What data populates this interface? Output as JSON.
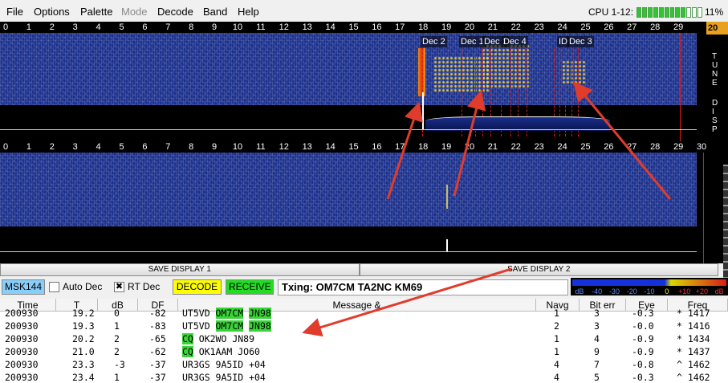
{
  "menu": {
    "items": [
      {
        "label": "File",
        "enabled": true
      },
      {
        "label": "Options",
        "enabled": true
      },
      {
        "label": "Palette",
        "enabled": true
      },
      {
        "label": "Mode",
        "enabled": false
      },
      {
        "label": "Decode",
        "enabled": true
      },
      {
        "label": "Band",
        "enabled": true
      },
      {
        "label": "Help",
        "enabled": true
      }
    ]
  },
  "cpu": {
    "label": "CPU 1-12:",
    "percent": "11%",
    "level": 0.75
  },
  "scale": {
    "ticks": [
      "0",
      "1",
      "2",
      "3",
      "4",
      "5",
      "6",
      "7",
      "8",
      "9",
      "10",
      "11",
      "12",
      "13",
      "14",
      "15",
      "16",
      "17",
      "18",
      "19",
      "20",
      "21",
      "22",
      "23",
      "24",
      "25",
      "26",
      "27",
      "28",
      "29",
      "30"
    ]
  },
  "waterfall_tags": [
    "Dec 2",
    "Dec 1",
    "Dec 1",
    "Dec 4",
    "ID",
    "Dec 3"
  ],
  "side_letters": [
    "T",
    "U",
    "N",
    "E",
    "D",
    "I",
    "S",
    "P"
  ],
  "side_top_label": "20",
  "save": {
    "display1": "SAVE DISPLAY 1",
    "display2": "SAVE DISPLAY 2"
  },
  "controls": {
    "mode": "MSK144",
    "auto_dec": "Auto Dec",
    "auto_dec_checked": false,
    "rt_dec": "RT Dec",
    "rt_dec_checked": true,
    "decode": "DECODE",
    "receive": "RECEIVE",
    "txing": "Txing: OM7CM TA2NC KM69",
    "colors": {
      "mode": "#87cefa",
      "decode": "#ffff00",
      "receive": "#22dd22"
    }
  },
  "meter": {
    "scale": [
      "dB",
      "-40",
      "-30",
      "-20",
      "-10",
      "0",
      "+10",
      "+20",
      "dB"
    ]
  },
  "table": {
    "headers": [
      "Time",
      "T",
      "dB",
      "DF",
      "Message &",
      "Navg",
      "Bit err",
      "Eye",
      "Freq"
    ],
    "rows": [
      {
        "time": "200930",
        "t": "19.2",
        "db": "0",
        "df": "-82",
        "msg": [
          {
            "t": "UT5VD ",
            "h": false
          },
          {
            "t": "OM7CM",
            "h": true
          },
          {
            "t": " ",
            "h": false
          },
          {
            "t": "JN98",
            "h": true
          }
        ],
        "navg": "1",
        "biterr": "3",
        "eye": "-0.3",
        "freq": "* 1417"
      },
      {
        "time": "200930",
        "t": "19.3",
        "db": "1",
        "df": "-83",
        "msg": [
          {
            "t": "UT5VD ",
            "h": false
          },
          {
            "t": "OM7CM",
            "h": true
          },
          {
            "t": " ",
            "h": false
          },
          {
            "t": "JN98",
            "h": true
          }
        ],
        "navg": "2",
        "biterr": "3",
        "eye": "-0.0",
        "freq": "* 1416"
      },
      {
        "time": "200930",
        "t": "20.2",
        "db": "2",
        "df": "-65",
        "msg": [
          {
            "t": "CQ",
            "h": true
          },
          {
            "t": " OK2WO JN89",
            "h": false
          }
        ],
        "navg": "1",
        "biterr": "4",
        "eye": "-0.9",
        "freq": "* 1434"
      },
      {
        "time": "200930",
        "t": "21.0",
        "db": "2",
        "df": "-62",
        "msg": [
          {
            "t": "CQ",
            "h": true
          },
          {
            "t": " OK1AAM JO60",
            "h": false
          }
        ],
        "navg": "1",
        "biterr": "9",
        "eye": "-0.9",
        "freq": "* 1437"
      },
      {
        "time": "200930",
        "t": "23.3",
        "db": "-3",
        "df": "-37",
        "msg": [
          {
            "t": "UR3GS 9A5ID +04",
            "h": false
          }
        ],
        "navg": "4",
        "biterr": "7",
        "eye": "-0.8",
        "freq": "^ 1462"
      },
      {
        "time": "200930",
        "t": "23.4",
        "db": "1",
        "df": "-37",
        "msg": [
          {
            "t": "UR3GS 9A5ID +04",
            "h": false
          }
        ],
        "navg": "4",
        "biterr": "5",
        "eye": "-0.3",
        "freq": "^ 1462"
      }
    ]
  }
}
